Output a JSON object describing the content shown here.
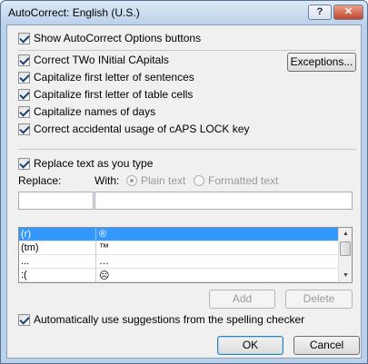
{
  "window": {
    "title": "AutoCorrect: English (U.S.)",
    "help_label": "?",
    "close_label": "✕"
  },
  "options": {
    "show_buttons": "Show AutoCorrect Options buttons",
    "two_initial": "Correct TWo INitial CApitals",
    "first_sentence": "Capitalize first letter of sentences",
    "first_table": "Capitalize first letter of table cells",
    "names_days": "Capitalize names of days",
    "caps_lock": "Correct accidental usage of cAPS LOCK key",
    "exceptions_label": "Exceptions..."
  },
  "replace": {
    "checkbox_label": "Replace text as you type",
    "replace_label": "Replace:",
    "with_label": "With:",
    "plain_text": "Plain text",
    "formatted_text": "Formatted text",
    "replace_value": "",
    "with_value": ""
  },
  "entries": [
    {
      "from": "(r)",
      "to": "®"
    },
    {
      "from": "(tm)",
      "to": "™"
    },
    {
      "from": "...",
      "to": "…"
    },
    {
      "from": ":(",
      "to": "☹"
    }
  ],
  "buttons": {
    "add": "Add",
    "delete": "Delete",
    "ok": "OK",
    "cancel": "Cancel"
  },
  "suggestions_label": "Automatically use suggestions from the spelling checker"
}
